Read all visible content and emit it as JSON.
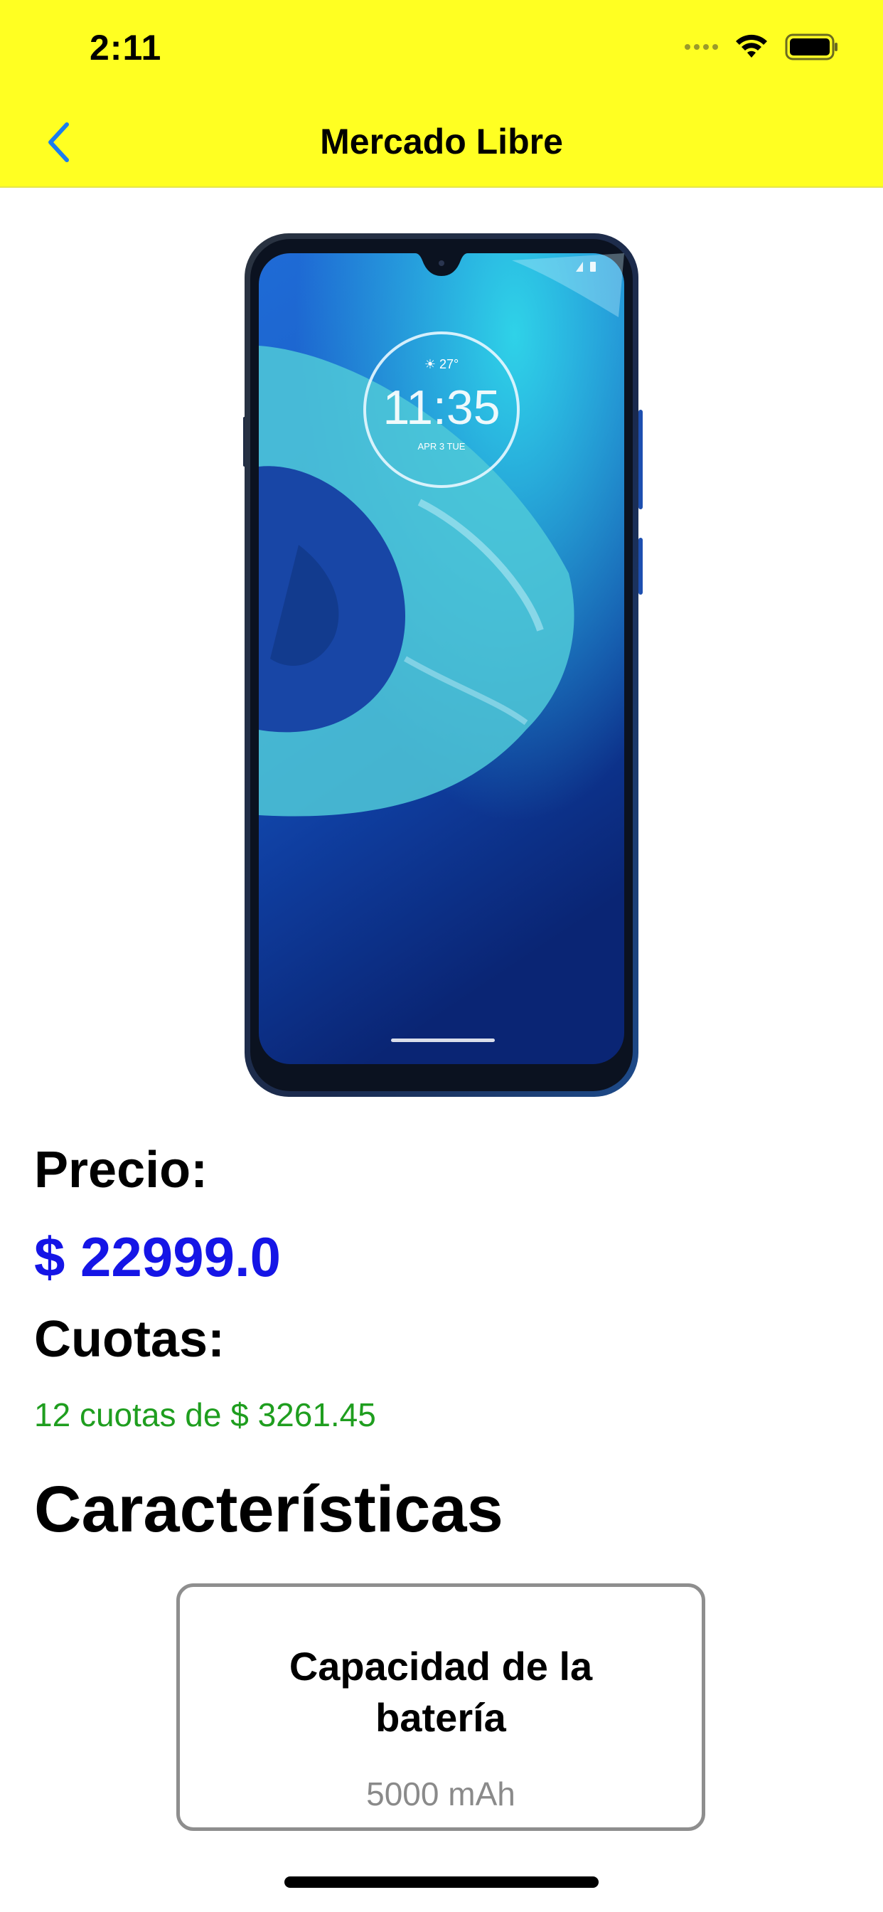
{
  "status_bar": {
    "time": "2:11",
    "signal_icon": "cellular-dots-icon",
    "wifi_icon": "wifi-icon",
    "battery_icon": "battery-full-icon"
  },
  "nav": {
    "title": "Mercado Libre",
    "back_icon": "chevron-left-icon"
  },
  "colors": {
    "header_bg": "#ffff22",
    "accent_blue": "#1515e6",
    "price_blue": "#1515e6",
    "cuotas_green": "#1f9e1f",
    "card_border": "#8e8e8e"
  },
  "product": {
    "image": {
      "type": "smartphone-photo",
      "lockscreen_time": "11:35",
      "lockscreen_temp": "27°",
      "lockscreen_date": "APR 3 TUE"
    },
    "price_label": "Precio:",
    "price_value": "$ 22999.0",
    "cuotas_label": "Cuotas:",
    "cuotas_value": "12 cuotas de $ 3261.45"
  },
  "features": {
    "title": "Características",
    "items": [
      {
        "name": "Capacidad de la batería",
        "value": "5000 mAh"
      }
    ]
  }
}
